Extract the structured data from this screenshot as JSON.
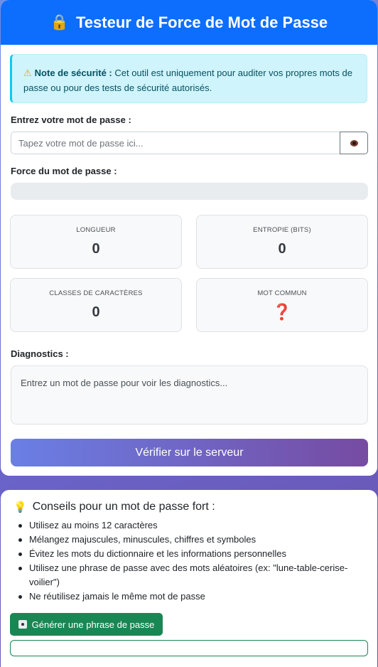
{
  "header": {
    "title": "Testeur de Force de Mot de Passe",
    "icon": "lock-icon"
  },
  "alert": {
    "title": "Note de sécurité :",
    "text": " Cet outil est uniquement pour auditer vos propres mots de passe ou pour des tests de sécurité autorisés.",
    "icon": "warning-icon"
  },
  "password": {
    "label": "Entrez votre mot de passe :",
    "placeholder": "Tapez votre mot de passe ici...",
    "value": "",
    "toggle_icon": "eye-icon"
  },
  "strength": {
    "label": "Force du mot de passe :",
    "level": 0
  },
  "stats": [
    {
      "label": "LONGUEUR",
      "value": "0"
    },
    {
      "label": "ENTROPIE (BITS)",
      "value": "0"
    },
    {
      "label": "CLASSES DE CARACTÈRES",
      "value": "0"
    },
    {
      "label": "MOT COMMUN",
      "value": "❓"
    }
  ],
  "diagnostics": {
    "label": "Diagnostics :",
    "text": "Entrez un mot de passe pour voir les diagnostics..."
  },
  "verify_button": "Vérifier sur le serveur",
  "tips": {
    "title": "Conseils pour un mot de passe fort :",
    "icon": "lightbulb-icon",
    "items": [
      "Utilisez au moins 12 caractères",
      "Mélangez majuscules, minuscules, chiffres et symboles",
      "Évitez les mots du dictionnaire et les informations personnelles",
      "Utilisez une phrase de passe avec des mots aléatoires (ex: \"lune-table-cerise-voilier\")",
      "Ne réutilisez jamais le même mot de passe"
    ]
  },
  "generate_button": "Générer une phrase de passe",
  "generated_passphrase": "",
  "colors": {
    "primary": "#0d6efd",
    "success": "#198754",
    "info_bg": "#cff4fc"
  }
}
